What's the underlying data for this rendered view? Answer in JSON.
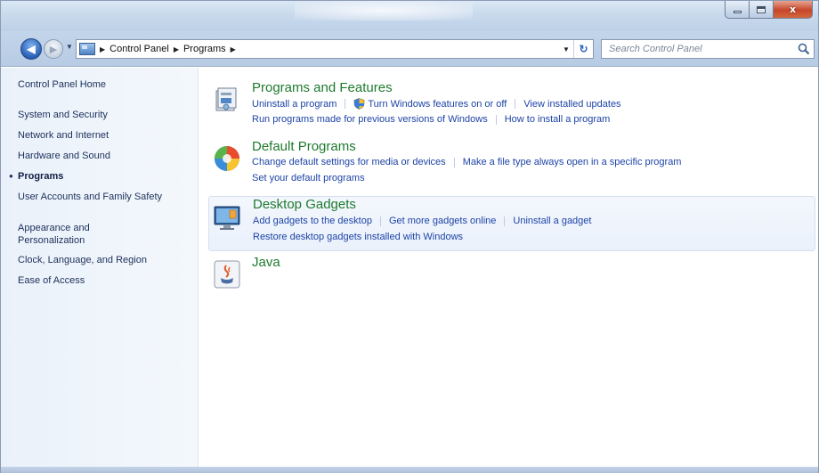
{
  "window": {
    "caption_buttons": {
      "minimize_icon": "minimize-icon",
      "maximize_icon": "maximize-icon",
      "close_icon": "close-icon",
      "close_glyph": "x"
    }
  },
  "nav": {
    "back_icon": "back-arrow-icon",
    "forward_icon": "forward-arrow-icon"
  },
  "address": {
    "crumbs": [
      "Control Panel",
      "Programs"
    ]
  },
  "search": {
    "placeholder": "Search Control Panel"
  },
  "sidebar": {
    "items": [
      {
        "label": "Control Panel Home"
      },
      {
        "label": "System and Security"
      },
      {
        "label": "Network and Internet"
      },
      {
        "label": "Hardware and Sound"
      },
      {
        "label": "Programs",
        "active": true
      },
      {
        "label": "User Accounts and Family Safety"
      },
      {
        "label": "Appearance and Personalization"
      },
      {
        "label": "Clock, Language, and Region"
      },
      {
        "label": "Ease of Access"
      }
    ]
  },
  "categories": [
    {
      "title": "Programs and Features",
      "icon": "programs-features-icon",
      "links_row1": [
        "Uninstall a program",
        "Turn Windows features on or off",
        "View installed updates"
      ],
      "links_row2": [
        "Run programs made for previous versions of Windows",
        "How to install a program"
      ]
    },
    {
      "title": "Default Programs",
      "icon": "default-programs-icon",
      "links_row1": [
        "Change default settings for media or devices",
        "Make a file type always open in a specific program"
      ],
      "links_row2": [
        "Set your default programs"
      ]
    },
    {
      "title": "Desktop Gadgets",
      "icon": "desktop-gadgets-icon",
      "links_row1": [
        "Add gadgets to the desktop",
        "Get more gadgets online",
        "Uninstall a gadget"
      ],
      "links_row2": [
        "Restore desktop gadgets installed with Windows"
      ]
    },
    {
      "title": "Java",
      "icon": "java-icon"
    }
  ],
  "colors": {
    "category_title": "#1f7a2f",
    "link": "#1d43a6",
    "sidebar_text": "#1b2f5a"
  }
}
